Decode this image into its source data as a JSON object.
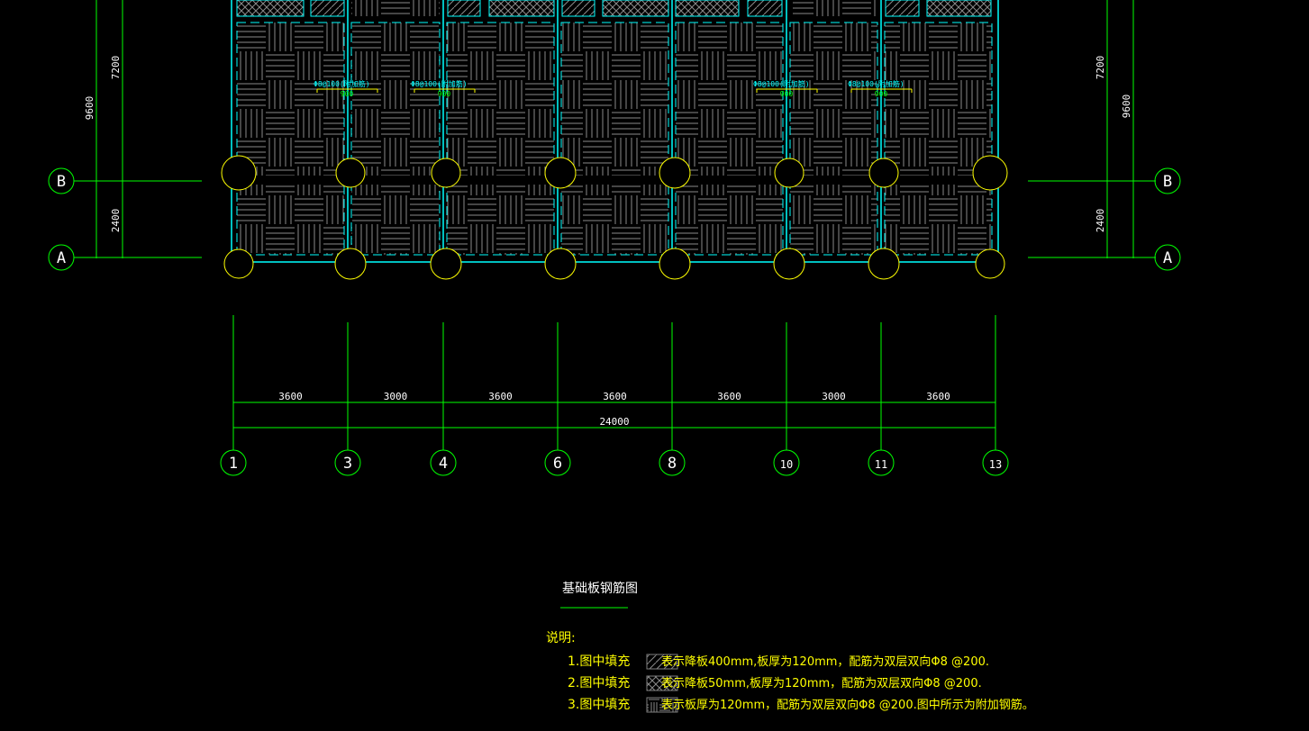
{
  "drawing": {
    "title": "基础板钢筋图",
    "notes_heading": "说明:",
    "notes": [
      {
        "label": "1.图中填充",
        "hatch": "diagonal",
        "text": "表示降板400mm,板厚为120mm，配筋为双层双向Φ8 @200."
      },
      {
        "label": "2.图中填充",
        "hatch": "crosshatch",
        "text": "表示降板50mm,板厚为120mm，配筋为双层双向Φ8 @200."
      },
      {
        "label": "3.图中填充",
        "hatch": "basketweave",
        "text": "表示板厚为120mm，配筋为双层双向Φ8 @200.图中所示为附加钢筋。"
      }
    ]
  },
  "column_axes": [
    "1",
    "3",
    "4",
    "6",
    "8",
    "10",
    "11",
    "13"
  ],
  "row_axes": [
    "B",
    "A"
  ],
  "bay_dimensions": [
    "3600",
    "3000",
    "3600",
    "3600",
    "3600",
    "3000",
    "3600"
  ],
  "total_dimension": "24000",
  "vertical_dimensions": {
    "overall": "9600",
    "upper": "7200",
    "lower": "2400"
  },
  "rebar_annotations": [
    {
      "text": "Φ8@100(附加筋)",
      "length": "900"
    },
    {
      "text": "Φ8@100(附加筋)",
      "length": "900"
    },
    {
      "text": "Φ8@100(附加筋)",
      "length": "900"
    },
    {
      "text": "Φ8@100(附加筋)",
      "length": "900"
    }
  ],
  "colors": {
    "grid": "#00ff00",
    "slab": "#00ffff",
    "column": "#ffff00",
    "hatch": "#808080",
    "text": "#ffffff",
    "note": "#ffff00"
  }
}
